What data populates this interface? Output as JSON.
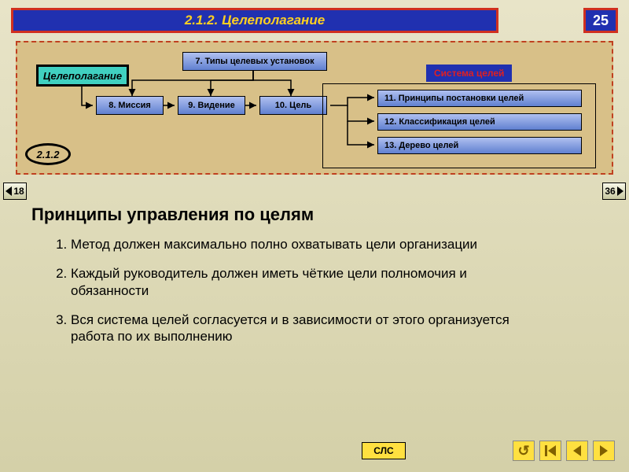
{
  "header": {
    "title": "2.1.2. Целеполагание",
    "page_number": "25"
  },
  "diagram": {
    "root_label": "Целеполагание",
    "section_number": "2.1.2",
    "system_label": "Система целей",
    "nodes": {
      "n7": "7. Типы целевых установок",
      "n8": "8. Миссия",
      "n9": "9. Видение",
      "n10": "10. Цель",
      "n11": "11. Принципы постановки целей",
      "n12": "12. Классификация целей",
      "n13": "13. Дерево целей"
    }
  },
  "side_nav": {
    "prev": "18",
    "next": "36"
  },
  "content": {
    "title": "Принципы управления по целям",
    "items": [
      "Метод должен максимально полно охватывать цели организации",
      "Каждый руководитель должен иметь чёткие цели полномочия и обязанности",
      "Вся система целей согласуется и в зависимости от этого организуется работа по их выполнению"
    ]
  },
  "footer": {
    "sls_label": "СЛС"
  }
}
